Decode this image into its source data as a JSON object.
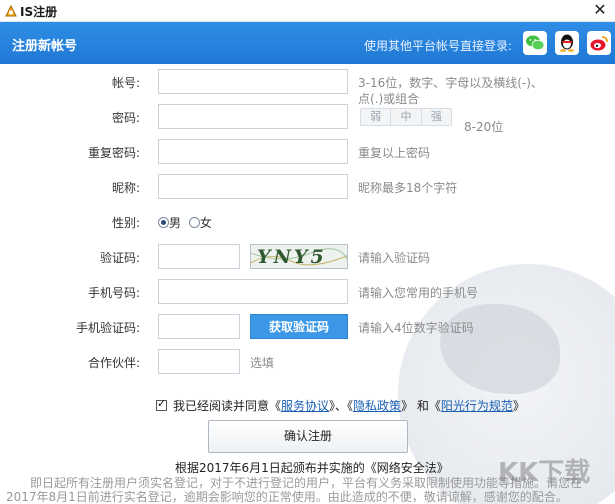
{
  "window": {
    "title": "IS注册"
  },
  "header": {
    "title": "注册新帐号",
    "social_login_text": "使用其他平台帐号直接登录:"
  },
  "form": {
    "account": {
      "label": "帐号:",
      "hint_line1": "3-16位，数字、字母以及横线(-)、",
      "hint_line2": "点(.)或组合"
    },
    "password": {
      "label": "密码:",
      "strength": [
        "弱",
        "中",
        "强"
      ],
      "hint": "8-20位"
    },
    "confirm_password": {
      "label": "重复密码:",
      "hint": "重复以上密码"
    },
    "nickname": {
      "label": "昵称:",
      "hint": "昵称最多18个字符"
    },
    "gender": {
      "label": "性别:",
      "male": "男",
      "female": "女",
      "selected": "男"
    },
    "captcha": {
      "label": "验证码:",
      "image_text": "YNY5",
      "hint": "请输入验证码"
    },
    "phone": {
      "label": "手机号码:",
      "hint": "请输入您常用的手机号"
    },
    "sms_code": {
      "label": "手机验证码:",
      "button": "获取验证码",
      "hint": "请输入4位数字验证码"
    },
    "partner": {
      "label": "合作伙伴:",
      "hint": "选填"
    }
  },
  "agreement": {
    "prefix": "我已经阅读并同意《",
    "service": "服务协议",
    "sep1": "》、《",
    "privacy": "隐私政策",
    "sep2": "》 和《",
    "conduct": "阳光行为规范",
    "suffix": "》",
    "checked": true
  },
  "submit_label": "确认注册",
  "notice": {
    "title": "根据2017年6月1日起颁布并实施的《网络安全法》",
    "line1": "即日起所有注册用户须实名登记，对于不进行登记的用户，平台有义务采取限制使用功能等措施。请您在",
    "line2": "2017年8月1日前进行实名登记，逾期会影响您的正常使用。由此造成的不便，敬请谅解，感谢您的配合。"
  },
  "watermark": "KK下载",
  "colors": {
    "header": "#1f78d4",
    "sms_button": "#3c98e6",
    "link": "#1a5fb4"
  }
}
